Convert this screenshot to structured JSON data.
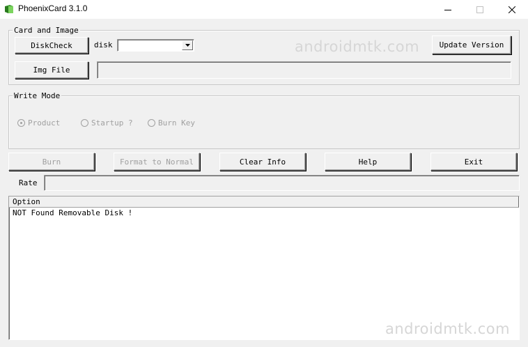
{
  "window": {
    "title": "PhoenixCard 3.1.0",
    "icon": "phoenixcard-book-icon",
    "controls": [
      "minimize-icon",
      "maximize-icon",
      "close-icon"
    ]
  },
  "card_image": {
    "legend": "Card and Image",
    "diskcheck_label": "DiskCheck",
    "disk_label": "disk",
    "disk_value": "",
    "update_label": "Update Version",
    "imgfile_label": "Img File",
    "imgfile_path": ""
  },
  "write_mode": {
    "legend": "Write Mode",
    "options": [
      {
        "label": "Product",
        "checked": true
      },
      {
        "label": "Startup ?",
        "checked": false
      },
      {
        "label": "Burn Key",
        "checked": false
      }
    ]
  },
  "actions": {
    "burn": "Burn",
    "format": "Format to Normal",
    "clear": "Clear Info",
    "help": "Help",
    "exit": "Exit"
  },
  "rate": {
    "label": "Rate",
    "progress": 0
  },
  "log": {
    "column": "Option",
    "lines": [
      "NOT Found Removable Disk !"
    ]
  },
  "watermark": "androidmtk.com"
}
